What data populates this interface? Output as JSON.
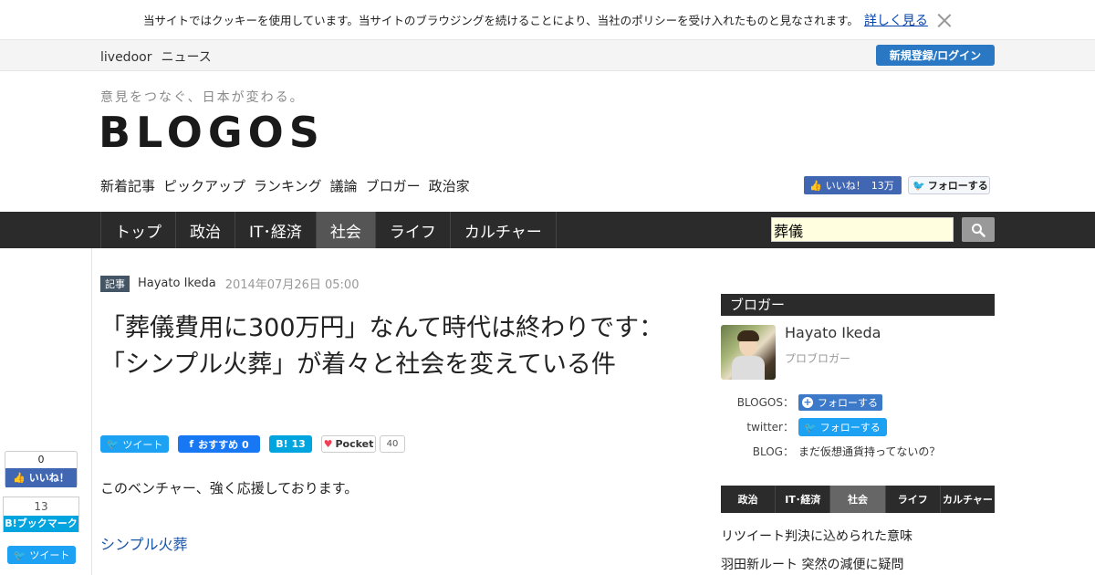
{
  "cookie": {
    "text": "当サイトではクッキーを使用しています。当サイトのブラウジングを続けることにより、当社のポリシーを受け入れたものと見なされます。",
    "more_label": "詳しく見る"
  },
  "topbar": {
    "brand_1": "livedoor",
    "brand_2": "ニュース",
    "login_label": "新規登録/ログイン"
  },
  "header": {
    "tagline": "意見をつなぐ、日本が変わる。",
    "logo": "BLOGOS",
    "subnav": [
      "新着記事",
      "ピックアップ",
      "ランキング",
      "議論",
      "ブロガー",
      "政治家"
    ],
    "fb_like_label": "いいね！",
    "fb_like_count": "13万",
    "tw_follow_label": "フォローする"
  },
  "mainnav": {
    "items": [
      "トップ",
      "政治",
      "IT･経済",
      "社会",
      "ライフ",
      "カルチャー"
    ],
    "active_index": 3,
    "search_value": "葬儀"
  },
  "left_share": {
    "like_count": "0",
    "like_label": "いいね！",
    "hatena_count": "13",
    "hatena_label": "B!ブックマーク",
    "tweet_label": "ツイート"
  },
  "article": {
    "tag": "記事",
    "author": "Hayato Ikeda",
    "date": "2014年07月26日 05:00",
    "title": "「葬儀費用に300万円」なんて時代は終わりです：「シンプル火葬」が着々と社会を変えている件",
    "share": {
      "tweet": "ツイート",
      "fb": "おすすめ 0",
      "hatena": "B! 13",
      "pocket": "Pocket",
      "pocket_count": "40"
    },
    "lead": "このベンチャー、強く応援しております。",
    "link": "シンプル火葬"
  },
  "sidebar": {
    "heading": "ブロガー",
    "blogger_name": "Hayato Ikeda",
    "blogger_role": "プロブロガー",
    "blogos_label": "BLOGOS：",
    "blogos_follow": "フォローする",
    "twitter_label": "twitter：",
    "twitter_follow": "フォローする",
    "blog_label": "BLOG：",
    "blog_name": "まだ仮想通貨持ってないの？",
    "cat_tabs": [
      "政治",
      "IT･経済",
      "社会",
      "ライフ",
      "カルチャー"
    ],
    "cat_active": 2,
    "news": [
      "リツイート判決に込められた意味",
      "羽田新ルート 突然の減便に疑問"
    ]
  },
  "colors": {
    "accent": "#2a78c4",
    "nav_bg": "#2b2b2b",
    "facebook": "#4267b2",
    "twitter": "#1da1f2",
    "hatena": "#00a4de"
  }
}
